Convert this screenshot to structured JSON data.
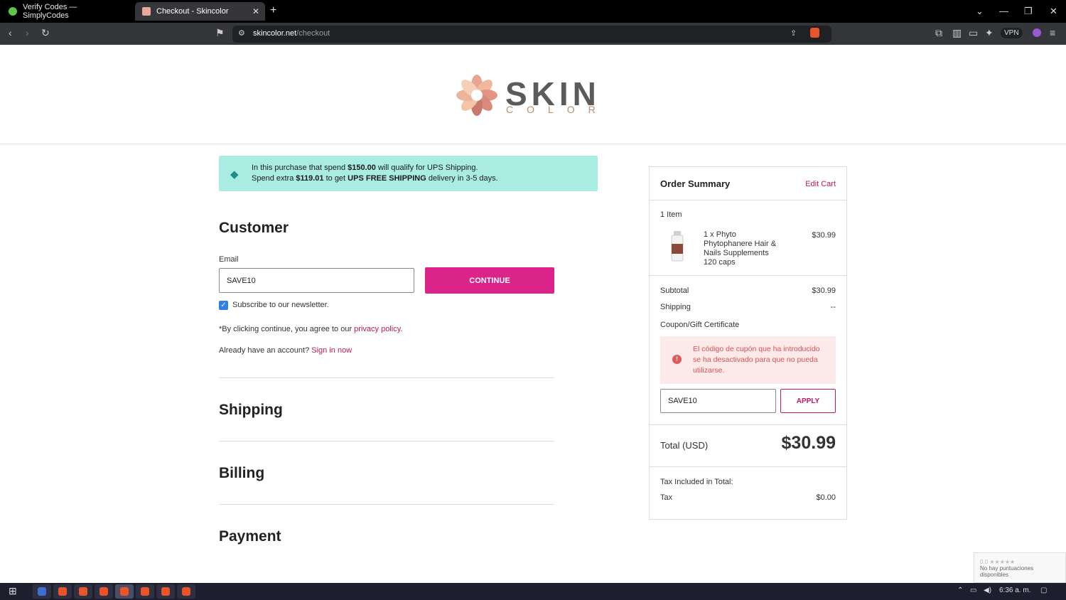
{
  "browser": {
    "tabs": [
      {
        "label": "Verify Codes — SimplyCodes"
      },
      {
        "label": "Checkout - Skincolor"
      }
    ],
    "url_domain": "skincolor.net",
    "url_path": "/checkout",
    "vpn_label": "VPN"
  },
  "logo": {
    "main": "SKIN",
    "sub": "COLOR"
  },
  "promo": {
    "line1_pre": "In this purchase that spend ",
    "line1_amount": "$150.00",
    "line1_post": " will qualify for UPS Shipping.",
    "line2_pre": "Spend extra ",
    "line2_amount": "$119.01",
    "line2_mid": " to get ",
    "line2_bold": "UPS FREE SHIPPING",
    "line2_post": " delivery in 3-5 days."
  },
  "customer": {
    "title": "Customer",
    "email_label": "Email",
    "email_value": "SAVE10",
    "continue_label": "CONTINUE",
    "newsletter_label": "Subscribe to our newsletter.",
    "terms_pre": "*By clicking continue, you agree to our ",
    "terms_link": "privacy policy",
    "terms_post": ".",
    "account_pre": "Already have an account? ",
    "account_link": "Sign in now"
  },
  "sections": {
    "shipping": "Shipping",
    "billing": "Billing",
    "payment": "Payment"
  },
  "summary": {
    "title": "Order Summary",
    "edit_cart": "Edit Cart",
    "item_count": "1 Item",
    "product_name": "1 x Phyto Phytophanere Hair & Nails Supplements 120 caps",
    "product_price": "$30.99",
    "subtotal_label": "Subtotal",
    "subtotal_value": "$30.99",
    "shipping_label": "Shipping",
    "shipping_value": "--",
    "coupon_label": "Coupon/Gift Certificate",
    "coupon_error": "El código de cupón que ha introducido se ha desactivado para que no pueda utilizarse.",
    "coupon_value": "SAVE10",
    "apply_label": "APPLY",
    "total_label": "Total (USD)",
    "total_value": "$30.99",
    "tax_included_label": "Tax Included in Total:",
    "tax_label": "Tax",
    "tax_value": "$0.00"
  },
  "recaptcha": {
    "stars": "0.0 ★★★★★",
    "text": "No hay puntuaciones disponibles"
  },
  "taskbar": {
    "time": "6:36 a. m."
  },
  "colors": {
    "accent": "#db2489",
    "promo_bg": "#a9ece2",
    "error": "#d9534f"
  }
}
